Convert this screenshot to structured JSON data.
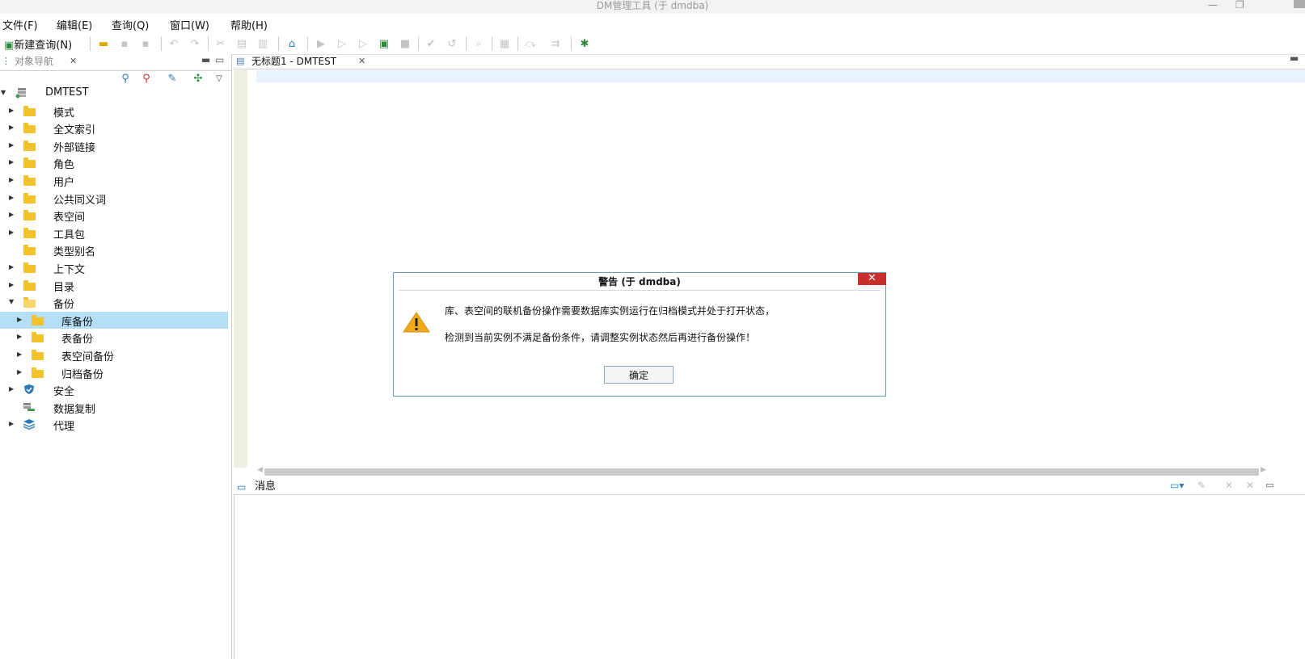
{
  "window": {
    "title": "DM管理工具 (于 dmdba)"
  },
  "menu": [
    "文件(F)",
    "编辑(E)",
    "查询(Q)",
    "窗口(W)",
    "帮助(H)"
  ],
  "toolbar": {
    "new_query_label": "新建查询(N)"
  },
  "navigator": {
    "tab_label": "对象导航",
    "tree": [
      {
        "label": "DMTEST",
        "level": 0,
        "expanded": true,
        "icon": "database-icon"
      },
      {
        "label": "模式",
        "level": 1,
        "icon": "folder-icon"
      },
      {
        "label": "全文索引",
        "level": 1,
        "icon": "folder-icon"
      },
      {
        "label": "外部链接",
        "level": 1,
        "icon": "folder-icon"
      },
      {
        "label": "角色",
        "level": 1,
        "icon": "folder-icon"
      },
      {
        "label": "用户",
        "level": 1,
        "icon": "folder-icon"
      },
      {
        "label": "公共同义词",
        "level": 1,
        "icon": "folder-icon"
      },
      {
        "label": "表空间",
        "level": 1,
        "icon": "folder-icon"
      },
      {
        "label": "工具包",
        "level": 1,
        "icon": "folder-icon"
      },
      {
        "label": "类型别名",
        "level": 1,
        "icon": "folder-icon",
        "no_arrow": true
      },
      {
        "label": "上下文",
        "level": 1,
        "icon": "folder-icon"
      },
      {
        "label": "目录",
        "level": 1,
        "icon": "folder-icon"
      },
      {
        "label": "备份",
        "level": 1,
        "icon": "folder-open-icon",
        "expanded": true
      },
      {
        "label": "库备份",
        "level": 2,
        "icon": "folder-icon",
        "selected": true
      },
      {
        "label": "表备份",
        "level": 2,
        "icon": "folder-icon"
      },
      {
        "label": "表空间备份",
        "level": 2,
        "icon": "folder-icon"
      },
      {
        "label": "归档备份",
        "level": 2,
        "icon": "folder-icon"
      },
      {
        "label": "安全",
        "level": 1,
        "icon": "shield-icon"
      },
      {
        "label": "数据复制",
        "level": 1,
        "icon": "replication-icon",
        "no_arrow": true
      },
      {
        "label": "代理",
        "level": 1,
        "icon": "layers-icon"
      }
    ]
  },
  "editor": {
    "tab_label": "无标题1 - DMTEST"
  },
  "messages": {
    "tab_label": "消息"
  },
  "dialog": {
    "title": "警告   (于 dmdba)",
    "line1": "库、表空间的联机备份操作需要数据库实例运行在归档模式并处于打开状态，",
    "line2": "检测到当前实例不满足备份条件，请调整实例状态然后再进行备份操作！",
    "ok_label": "确定",
    "close_glyph": "✕"
  },
  "colors": {
    "accent": "#2a7ab8",
    "folder": "#f2c22d",
    "selection": "#b5dff7",
    "close": "#c9302c",
    "warning": "#f0a91b"
  }
}
